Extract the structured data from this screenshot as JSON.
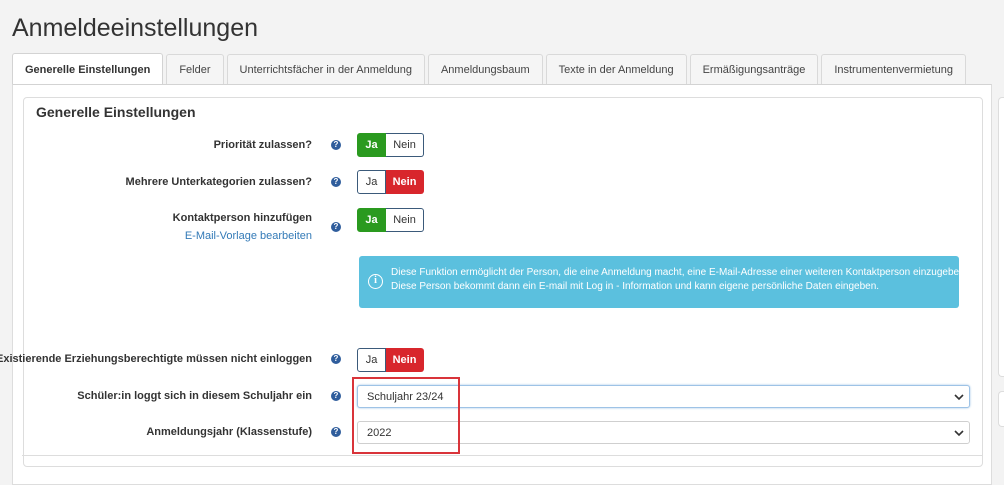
{
  "page": {
    "title": "Anmeldeeinstellungen"
  },
  "tabs": [
    {
      "label": "Generelle Einstellungen"
    },
    {
      "label": "Felder"
    },
    {
      "label": "Unterrichtsfächer in der Anmeldung"
    },
    {
      "label": "Anmeldungsbaum"
    },
    {
      "label": "Texte in der Anmeldung"
    },
    {
      "label": "Ermäßigungsanträge"
    },
    {
      "label": "Instrumentenvermietung"
    }
  ],
  "section": {
    "title": "Generelle Einstellungen"
  },
  "toggle_labels": {
    "yes": "Ja",
    "no": "Nein"
  },
  "settings": {
    "priority": {
      "label": "Priorität zulassen?",
      "value": "Ja"
    },
    "subcategories": {
      "label": "Mehrere Unterkategorien zulassen?",
      "value": "Nein"
    },
    "contact_person": {
      "label": "Kontaktperson hinzufügen",
      "link": "E-Mail-Vorlage bearbeiten",
      "value": "Ja",
      "info_line1": "Diese Funktion ermöglicht der Person, die eine Anmeldung macht, eine E-Mail-Adresse einer weiteren Kontaktperson einzugeben.",
      "info_line2": "Diese Person bekommt dann ein E-mail mit Log in - Information und kann eigene persönliche Daten eingeben."
    },
    "guardians": {
      "label": "Existierende Erziehungsberechtigte müssen nicht einloggen",
      "value": "Nein"
    },
    "school_year": {
      "label": "Schüler:in loggt sich in diesem Schuljahr ein",
      "selected": "Schuljahr 23/24"
    },
    "registration_year": {
      "label": "Anmeldungsjahr (Klassenstufe)",
      "selected": "2022"
    }
  },
  "icons": {
    "help": "question-circle-icon",
    "info": "info-circle-icon",
    "dropdown": "chevron-down-icon"
  },
  "colors": {
    "yes_active": "#2a9a1f",
    "no_active": "#d8262c",
    "info_bg": "#5bc0de",
    "link": "#337ab7",
    "highlight": "#d9343a"
  }
}
